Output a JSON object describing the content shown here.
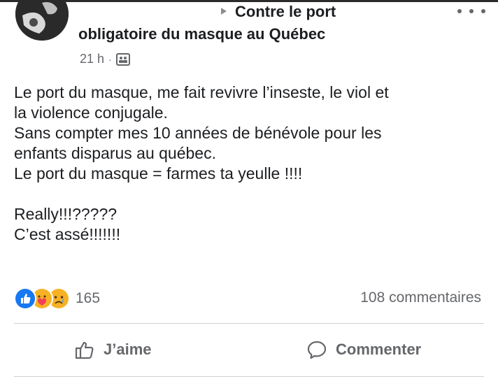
{
  "header": {
    "group_line": "Contre le port",
    "group_name_cont": "obligatoire du masque au Québec",
    "time": "21 h",
    "separator": "·",
    "audience_icon": "members-icon",
    "more_icon": "more-dots-icon"
  },
  "post": {
    "lines": [
      "Le port du masque, me fait revivre l’inseste, le viol et",
      "la violence conjugale.",
      "Sans compter mes 10 années de bénévole pour les",
      "enfants disparus au québec.",
      "Le port du masque = farmes ta yeulle !!!!",
      "",
      "Really!!!?????",
      "C’est assé!!!!!!!"
    ]
  },
  "stats": {
    "reaction_icons": [
      "like-reaction-icon",
      "care-reaction-icon",
      "sad-reaction-icon"
    ],
    "reaction_count": "165",
    "comments": "108 commentaires"
  },
  "actions": {
    "like_label": "J’aime",
    "comment_label": "Commenter"
  },
  "colors": {
    "text": "#1c1e21",
    "secondary": "#65676b",
    "like_blue": "#1877f2",
    "reaction_yellow": "#f7b125",
    "divider": "#ced0d4"
  }
}
